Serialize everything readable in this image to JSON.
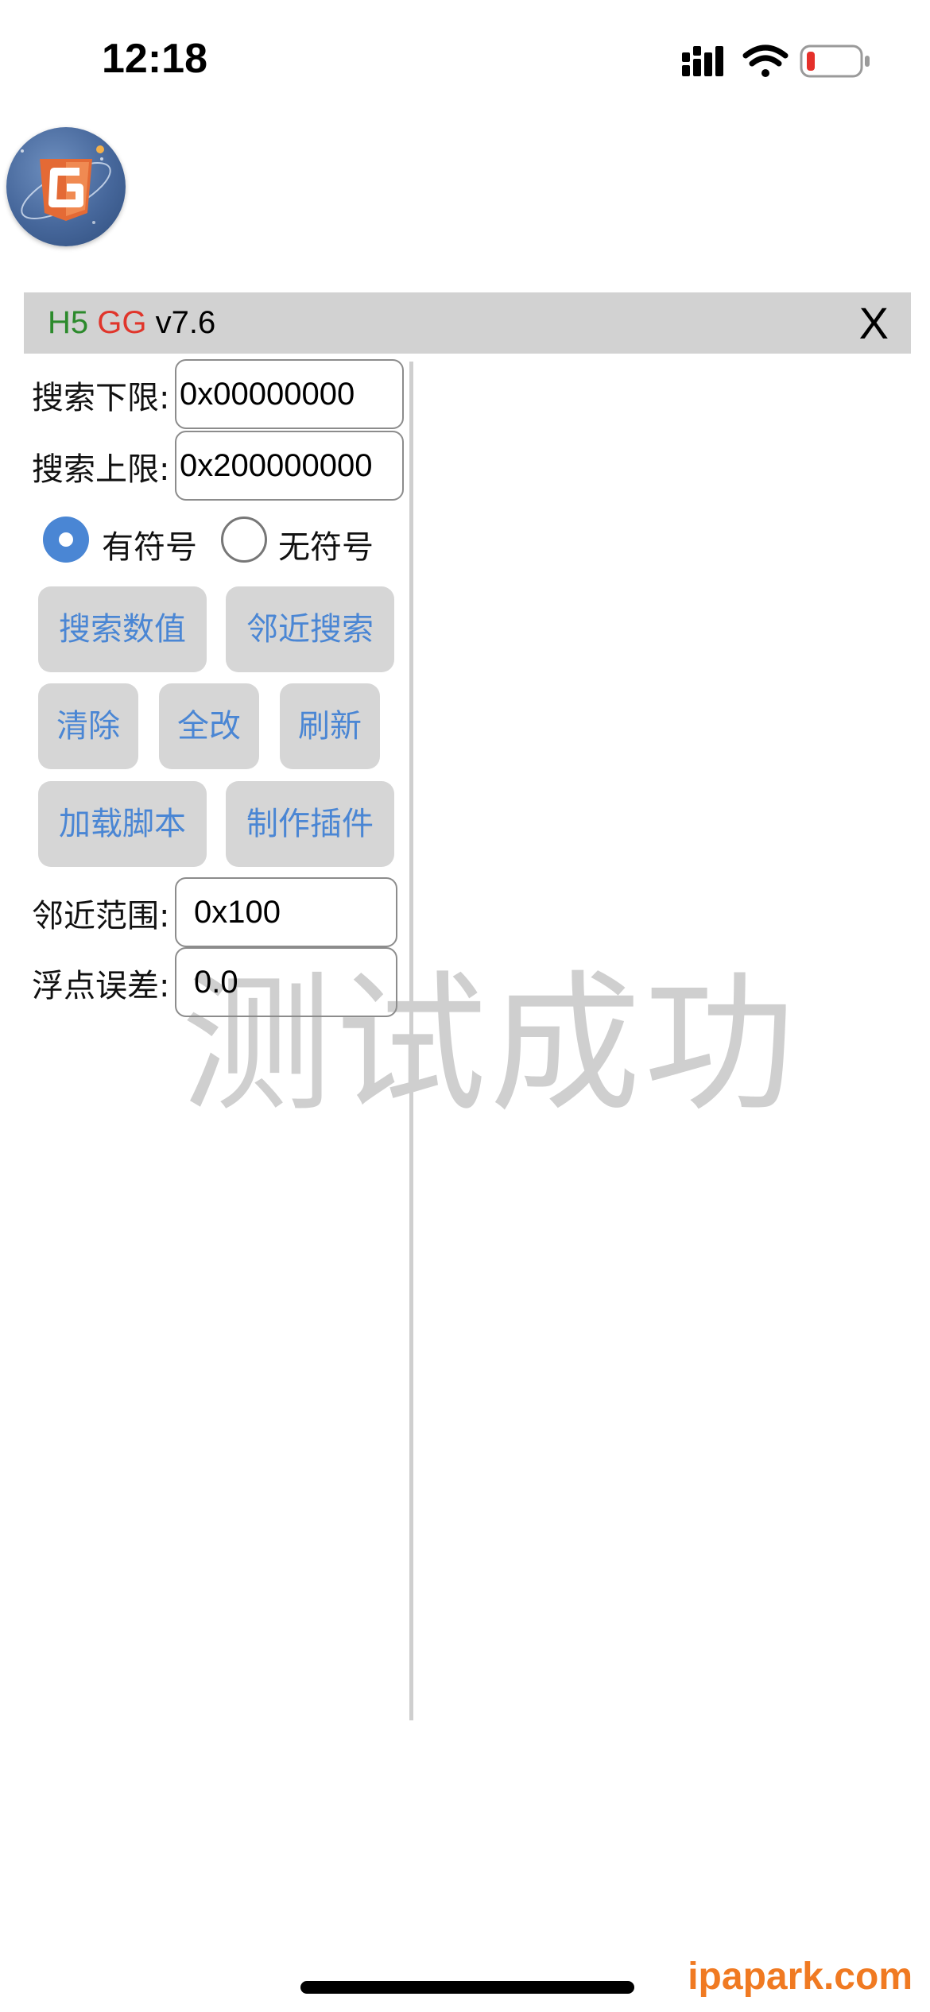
{
  "status_bar": {
    "time": "12:18"
  },
  "window": {
    "title_h5": "H5",
    "title_gg": "GG",
    "title_version": " v7.6",
    "close_label": "X"
  },
  "form": {
    "lower_label": "搜索下限:",
    "lower_value": "0x00000000",
    "upper_label": "搜索上限:",
    "upper_value": "0x200000000",
    "signed_label": "有符号",
    "unsigned_label": "无符号",
    "signed_selected": true,
    "range_label": "邻近范围:",
    "range_value": "0x100",
    "float_label": "浮点误差:",
    "float_value": "0.0"
  },
  "buttons": {
    "search_value": "搜索数值",
    "nearby_search": "邻近搜索",
    "clear": "清除",
    "modify_all": "全改",
    "refresh": "刷新",
    "load_script": "加载脚本",
    "make_plugin": "制作插件"
  },
  "overlay": {
    "success_text": "测试成功"
  },
  "footer": {
    "site_text": "ipapark.com"
  },
  "colors": {
    "accent_blue": "#4a86d4",
    "title_green": "#2c8a2c",
    "title_red": "#e0352b",
    "panel_gray": "#d2d2d2",
    "watermark_orange": "#f07a22"
  }
}
